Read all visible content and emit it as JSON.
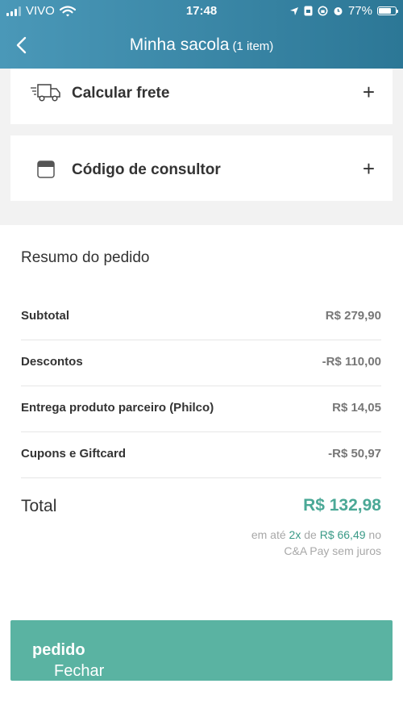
{
  "status_bar": {
    "carrier": "VIVO",
    "time": "17:48",
    "battery": "77%",
    "battery_level": 0.77
  },
  "nav": {
    "title": "Minha sacola",
    "item_count": "(1 item)",
    "back_icon": "chevron-left-icon"
  },
  "shipping": {
    "label": "Calcular frete",
    "icon": "delivery-truck-icon",
    "action": "+"
  },
  "consultant": {
    "label": "Código de consultor",
    "icon": "store-icon",
    "action": "+"
  },
  "summary": {
    "title": "Resumo do pedido",
    "rows": [
      {
        "label": "Subtotal",
        "value": "R$ 279,90"
      },
      {
        "label": "Descontos",
        "value": "-R$ 110,00"
      },
      {
        "label": "Entrega produto parceiro (Philco)",
        "value": "R$ 14,05"
      },
      {
        "label": "Cupons e Giftcard",
        "value": "-R$ 50,97"
      }
    ],
    "total_label": "Total",
    "total_value": "R$ 132,98",
    "installment": {
      "prefix": "em até",
      "times": "2x",
      "middle": "de",
      "amount": "R$ 66,49",
      "suffix": "no",
      "line2": "C&A Pay sem juros"
    }
  },
  "cta": {
    "prefix": "Fechar",
    "bold": "pedido"
  },
  "colors": {
    "header_start": "#4a98b8",
    "header_end": "#2c7796",
    "accent": "#5ab3a2",
    "total": "#4aa896"
  }
}
